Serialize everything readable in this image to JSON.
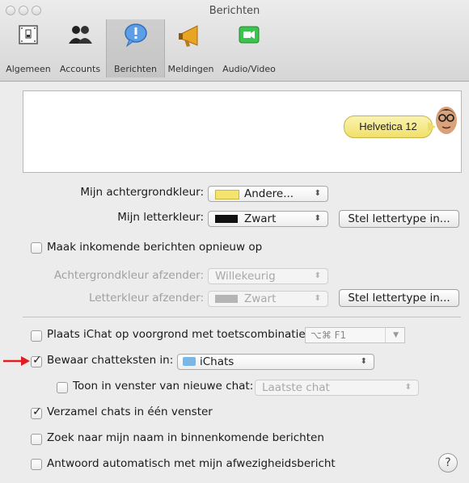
{
  "window": {
    "title": "Berichten"
  },
  "toolbar": {
    "items": [
      {
        "label": "Algemeen",
        "icon": "switch-icon"
      },
      {
        "label": "Accounts",
        "icon": "people-icon"
      },
      {
        "label": "Berichten",
        "icon": "speech-bubble-icon"
      },
      {
        "label": "Meldingen",
        "icon": "megaphone-icon"
      },
      {
        "label": "Audio/Video",
        "icon": "video-camera-icon"
      }
    ],
    "selected": "Berichten"
  },
  "preview": {
    "bubble_text": "Helvetica 12",
    "bubble_color": "#f3e37a"
  },
  "appearance": {
    "background_label": "Mijn achtergrondkleur:",
    "background_value": "Andere...",
    "background_swatch": "#f4e36c",
    "font_color_label": "Mijn letterkleur:",
    "font_color_value": "Zwart",
    "font_color_swatch": "#111111",
    "set_font_button": "Stel lettertype in..."
  },
  "reformat": {
    "checkbox_label": "Maak inkomende berichten opnieuw op",
    "checked": false,
    "sender_bg_label": "Achtergrondkleur afzender:",
    "sender_bg_value": "Willekeurig",
    "sender_font_label": "Letterkleur afzender:",
    "sender_font_value": "Zwart",
    "set_font_button": "Stel lettertype in..."
  },
  "options": {
    "foreground": {
      "label": "Plaats iChat op voorgrond met toetscombinatie:",
      "checked": false,
      "shortcut": "⌥⌘ F1"
    },
    "save_transcripts": {
      "label": "Bewaar chatteksten in:",
      "checked": true,
      "folder": "iChats"
    },
    "show_in_new_chat": {
      "label": "Toon in venster van nieuwe chat:",
      "checked": false,
      "value": "Laatste chat"
    },
    "collect_chats": {
      "label": "Verzamel chats in één venster",
      "checked": true
    },
    "search_name": {
      "label": "Zoek naar mijn naam in binnenkomende berichten",
      "checked": false
    },
    "auto_reply": {
      "label": "Antwoord automatisch met mijn afwezigheidsbericht",
      "checked": false
    }
  },
  "help": {
    "label": "?"
  },
  "colors": {
    "annotation_arrow": "#e02020"
  }
}
